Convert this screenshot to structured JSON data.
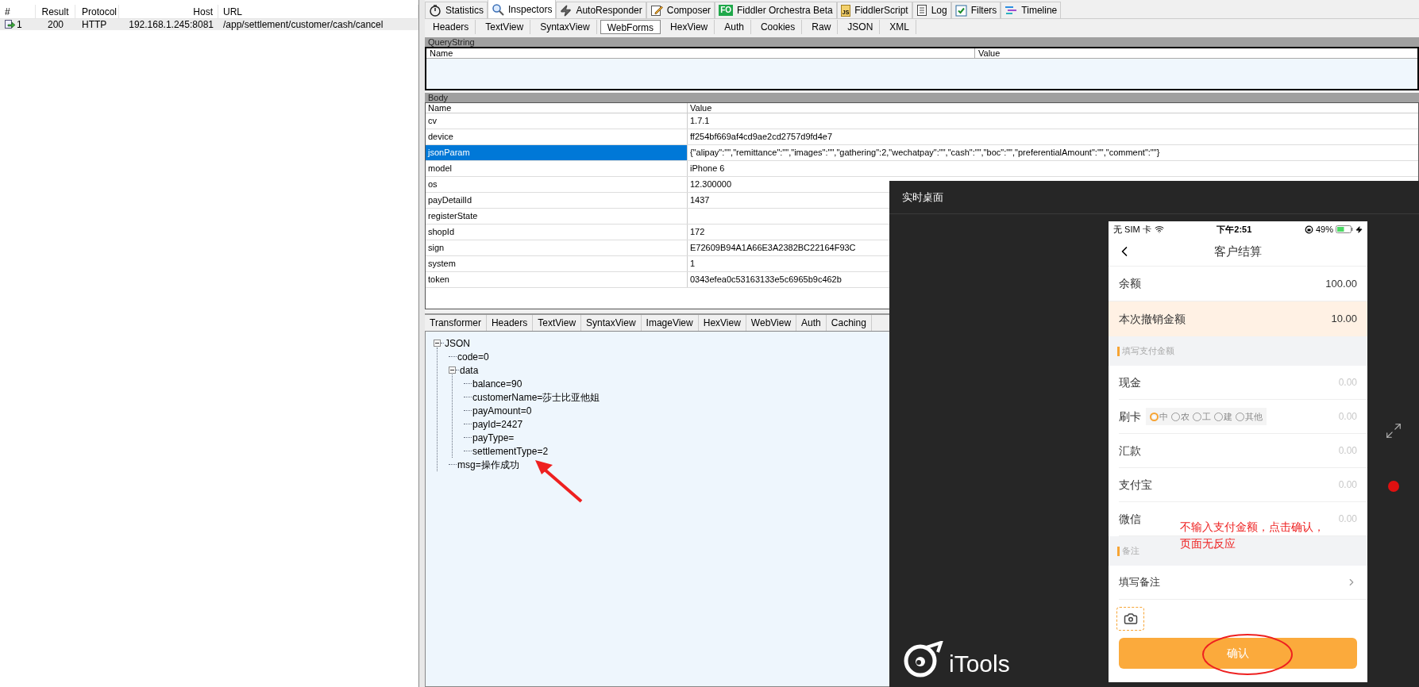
{
  "sessions": {
    "columns": [
      "#",
      "Result",
      "Protocol",
      "Host",
      "URL"
    ],
    "rows": [
      {
        "num": "1",
        "result": "200",
        "protocol": "HTTP",
        "host": "192.168.1.245:8081",
        "url": "/app/settlement/customer/cash/cancel",
        "selected": true
      }
    ]
  },
  "main_tabs": [
    {
      "label": "Statistics",
      "kind": "stopwatch",
      "selected": false
    },
    {
      "label": "Inspectors",
      "kind": "magnifier",
      "selected": true
    },
    {
      "label": "AutoResponder",
      "kind": "bolt",
      "selected": false
    },
    {
      "label": "Composer",
      "kind": "pencil",
      "selected": false
    },
    {
      "label": "Fiddler Orchestra Beta",
      "kind": "badge",
      "badge": "FO",
      "selected": false
    },
    {
      "label": "FiddlerScript",
      "kind": "scroll",
      "badge": "JS",
      "selected": false
    },
    {
      "label": "Log",
      "kind": "document",
      "selected": false
    },
    {
      "label": "Filters",
      "kind": "checkbox",
      "selected": false
    },
    {
      "label": "Timeline",
      "kind": "timeline",
      "selected": false
    }
  ],
  "request_tabs": [
    {
      "label": "Headers",
      "selected": false
    },
    {
      "label": "TextView",
      "selected": false
    },
    {
      "label": "SyntaxView",
      "selected": false
    },
    {
      "label": "WebForms",
      "selected": true
    },
    {
      "label": "HexView",
      "selected": false
    },
    {
      "label": "Auth",
      "selected": false
    },
    {
      "label": "Cookies",
      "selected": false
    },
    {
      "label": "Raw",
      "selected": false
    },
    {
      "label": "JSON",
      "selected": false
    },
    {
      "label": "XML",
      "selected": false
    }
  ],
  "querystring": {
    "title": "QueryString",
    "columns": [
      "Name",
      "Value"
    ]
  },
  "body": {
    "title": "Body",
    "columns": [
      "Name",
      "Value"
    ],
    "rows": [
      {
        "name": "cv",
        "value": "1.7.1",
        "selected": false
      },
      {
        "name": "device",
        "value": "ff254bf669af4cd9ae2cd2757d9fd4e7",
        "selected": false
      },
      {
        "name": "jsonParam",
        "value": "{\"alipay\":\"\",\"remittance\":\"\",\"images\":\"\",\"gathering\":2,\"wechatpay\":\"\",\"cash\":\"\",\"boc\":\"\",\"preferentialAmount\":\"\",\"comment\":\"\"}",
        "selected": true
      },
      {
        "name": "model",
        "value": "iPhone 6",
        "selected": false
      },
      {
        "name": "os",
        "value": "12.300000",
        "selected": false
      },
      {
        "name": "payDetailId",
        "value": "1437",
        "selected": false
      },
      {
        "name": "registerState",
        "selected": false
      },
      {
        "name": "shopId",
        "value": "172",
        "selected": false
      },
      {
        "name": "sign",
        "value": "E72609B94A1A66E3A2382BC22164F93C",
        "selected": false
      },
      {
        "name": "system",
        "value": "1",
        "selected": false
      },
      {
        "name": "token",
        "value": "0343efea0c53163133e5c6965b9c462b",
        "selected": false
      }
    ]
  },
  "response_tabs": [
    {
      "label": "Transformer",
      "selected": false
    },
    {
      "label": "Headers",
      "selected": false
    },
    {
      "label": "TextView",
      "selected": false
    },
    {
      "label": "SyntaxView",
      "selected": false
    },
    {
      "label": "ImageView",
      "selected": false
    },
    {
      "label": "HexView",
      "selected": false
    },
    {
      "label": "WebView",
      "selected": false
    },
    {
      "label": "Auth",
      "selected": false
    },
    {
      "label": "Caching",
      "selected": false
    }
  ],
  "json_tree": {
    "label": "JSON",
    "expanded": true,
    "children": [
      {
        "label": "code=0"
      },
      {
        "label": "data",
        "expanded": true,
        "children": [
          {
            "label": "balance=90"
          },
          {
            "label": "customerName=莎士比亚他姐"
          },
          {
            "label": "payAmount=0"
          },
          {
            "label": "payId=2427"
          },
          {
            "label": "payType="
          },
          {
            "label": "settlementType=2"
          }
        ]
      },
      {
        "label": "msg=操作成功"
      }
    ]
  },
  "mirror_window": {
    "title": "实时桌面",
    "logo": "iTools",
    "phone": {
      "carrier": "无 SIM 卡",
      "time": "下午2:51",
      "battery": "49%",
      "title": "客户结算",
      "rows": [
        {
          "kind": "info",
          "label": "余额",
          "value": "100.00",
          "highlighted": false
        },
        {
          "kind": "info",
          "label": "本次撤销金额",
          "value": "10.00",
          "highlighted": true
        },
        {
          "kind": "section",
          "label": "填写支付金额"
        },
        {
          "kind": "amount",
          "label": "现金",
          "placeholder": "0.00"
        },
        {
          "kind": "card",
          "label": "刷卡",
          "placeholder": "0.00",
          "options": [
            {
              "label": "中",
              "selected": true
            },
            {
              "label": "农",
              "selected": false
            },
            {
              "label": "工",
              "selected": false
            },
            {
              "label": "建",
              "selected": false
            },
            {
              "label": "其他",
              "selected": false
            }
          ]
        },
        {
          "kind": "amount",
          "label": "汇款",
          "placeholder": "0.00"
        },
        {
          "kind": "amount",
          "label": "支付宝",
          "placeholder": "0.00"
        },
        {
          "kind": "amount",
          "label": "微信",
          "placeholder": "0.00"
        },
        {
          "kind": "section",
          "label": "备注"
        },
        {
          "kind": "link",
          "label": "填写备注"
        },
        {
          "kind": "photo"
        }
      ],
      "confirm": "确认"
    },
    "note": [
      "不输入支付金额，点击确认，",
      "页面无反应"
    ]
  }
}
